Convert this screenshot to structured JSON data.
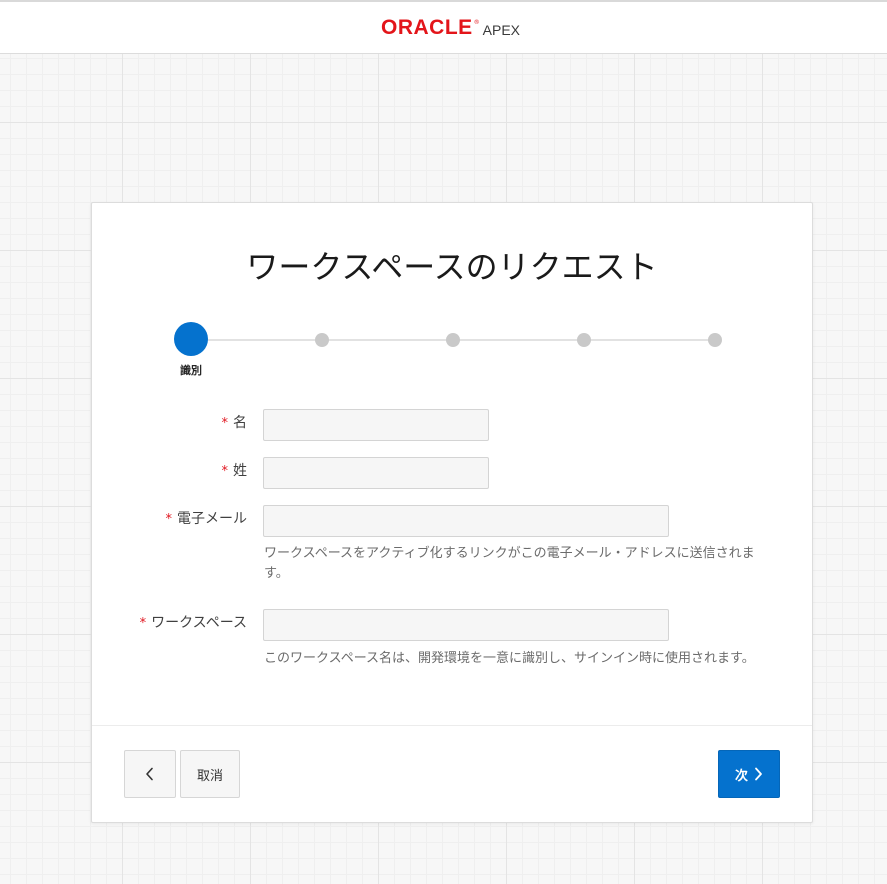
{
  "header": {
    "logo_brand": "ORACLE",
    "logo_registered": "®",
    "logo_product": "APEX"
  },
  "colors": {
    "brand_red": "#e3151a",
    "primary_blue": "#0572ce",
    "required_red": "#e0141e"
  },
  "wizard": {
    "title": "ワークスペースのリクエスト",
    "current_step": 1,
    "total_steps": 5,
    "current_step_label": "識別"
  },
  "form": {
    "first_name": {
      "required": "*",
      "label": "名",
      "value": ""
    },
    "last_name": {
      "required": "*",
      "label": "姓",
      "value": ""
    },
    "email": {
      "required": "*",
      "label": "電子メール",
      "value": "",
      "help": "ワークスペースをアクティブ化するリンクがこの電子メール・アドレスに送信されます。"
    },
    "workspace": {
      "required": "*",
      "label": "ワークスペース",
      "value": "",
      "help": "このワークスペース名は、開発環境を一意に識別し、サインイン時に使用されます。"
    }
  },
  "buttons": {
    "back_icon": "chevron-left-icon",
    "cancel_label": "取消",
    "next_label": "次",
    "next_icon": "chevron-right-icon"
  }
}
